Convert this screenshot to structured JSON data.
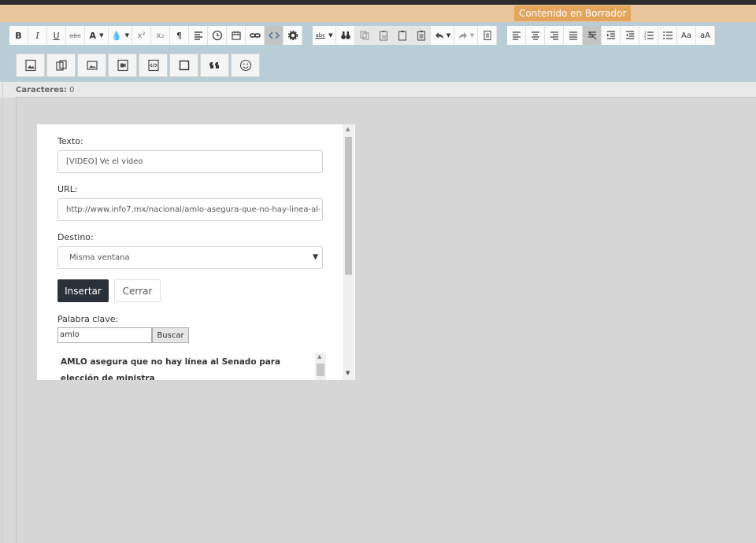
{
  "status_badge": "Contenido en Borrador",
  "toolbar1": {
    "bold": "B",
    "italic": "I",
    "underline": "U",
    "strike": "abc",
    "font_color": "A",
    "superscript": "x²",
    "subscript": "x₂",
    "paragraph": "¶",
    "spellcheck": "abc",
    "font_size": "Aa",
    "font_size_small": "aA"
  },
  "toolbar_icons": [
    "bold-icon",
    "italic-icon",
    "underline-icon",
    "strikethrough-icon",
    "font-color-icon",
    "fill-color-icon",
    "superscript-icon",
    "subscript-icon",
    "paragraph-icon",
    "align-left-icon",
    "clock-icon",
    "calendar-icon",
    "link-icon",
    "code-icon",
    "gear-icon",
    "spellcheck-icon",
    "binoculars-icon",
    "copy-icon",
    "paste-word-icon",
    "paste-icon",
    "paste-text-icon",
    "undo-icon",
    "redo-icon",
    "document-icon",
    "align-left-icon",
    "align-center-icon",
    "align-right-icon",
    "align-justify-icon",
    "clear-format-icon",
    "indent-icon",
    "outdent-icon",
    "numbered-list-icon",
    "bullet-list-icon",
    "font-size-icon",
    "case-icon"
  ],
  "toolbar2_icons": [
    "image-icon",
    "gallery-icon",
    "photo-icon",
    "video-icon",
    "embed-icon",
    "square-icon",
    "quote-icon",
    "smiley-icon"
  ],
  "editor": {
    "chars_label": "Caracteres:",
    "chars_value": "0"
  },
  "dialog": {
    "text_label": "Texto:",
    "text_value": "[VIDEO] Ve el video",
    "url_label": "URL:",
    "url_value": "http://www.info7.mx/nacional/amlo-asegura-que-no-hay-linea-al-",
    "target_label": "Destino:",
    "target_value": "Misma ventana",
    "insert_label": "Insertar",
    "close_label": "Cerrar",
    "keyword_label": "Palabra clave:",
    "keyword_value": "amlo",
    "search_label": "Buscar",
    "result_title": "AMLO asegura que no hay línea al Senado para elección de ministra"
  }
}
